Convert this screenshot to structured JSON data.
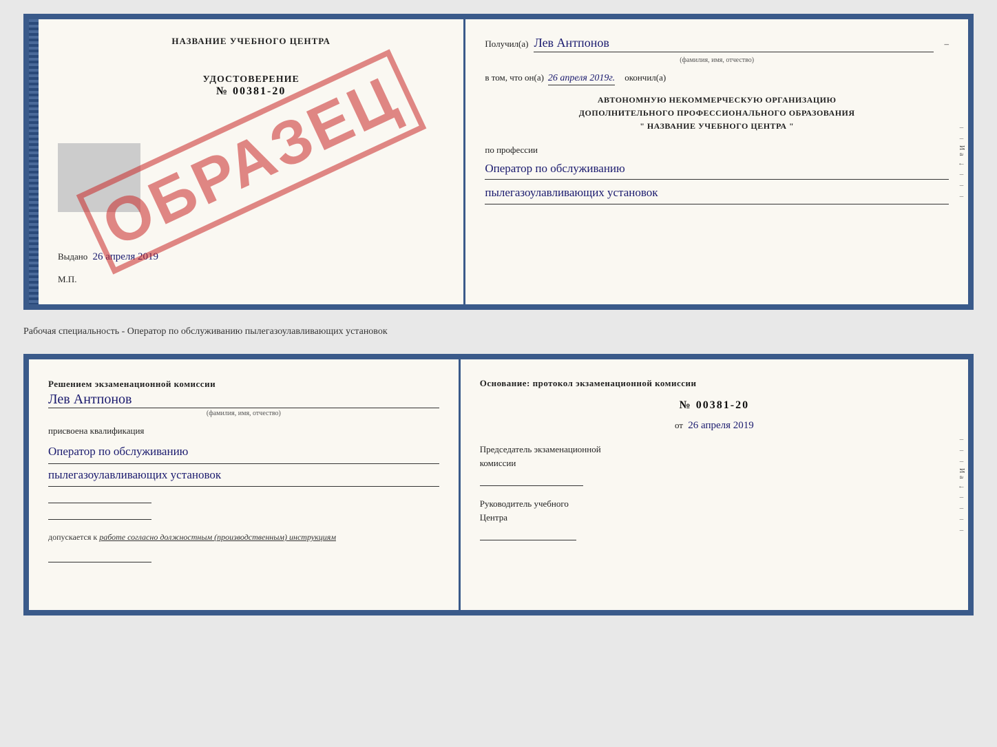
{
  "topBook": {
    "leftPage": {
      "header": "НАЗВАНИЕ УЧЕБНОГО ЦЕНТРА",
      "stamp": "ОБРАЗЕЦ",
      "udostoverenie_label": "УДОСТОВЕРЕНИЕ",
      "number": "№ 00381-20",
      "vydano_label": "Выдано",
      "vydano_date": "26 апреля 2019",
      "mp": "М.П."
    },
    "rightPage": {
      "poluchil_label": "Получил(а)",
      "recipient_name": "Лев Антпонов",
      "fio_subtitle": "(фамилия, имя, отчество)",
      "vtom_prefix": "в том, что он(а)",
      "vtom_date": "26 апреля 2019г.",
      "okoncil_label": "окончил(а)",
      "org_line1": "АВТОНОМНУЮ НЕКОММЕРЧЕСКУЮ ОРГАНИЗАЦИЮ",
      "org_line2": "ДОПОЛНИТЕЛЬНОГО ПРОФЕССИОНАЛЬНОГО ОБРАЗОВАНИЯ",
      "org_line3": "\"   НАЗВАНИЕ УЧЕБНОГО ЦЕНТРА   \"",
      "po_professii": "по профессии",
      "profession_line1": "Оператор по обслуживанию",
      "profession_line2": "пылегазоулавливающих установок"
    }
  },
  "separator": {
    "text": "Рабочая специальность - Оператор по обслуживанию пылегазоулавливающих установок"
  },
  "bottomBook": {
    "leftPage": {
      "resheniem_label": "Решением экзаменационной комиссии",
      "name": "Лев Антпонов",
      "fio_subtitle": "(фамилия, имя, отчество)",
      "prisvoena_label": "присвоена квалификация",
      "qualification_line1": "Оператор по обслуживанию",
      "qualification_line2": "пылегазоулавливающих установок",
      "dopuskaetsya_prefix": "допускается к",
      "dopuskaetsya_text": "работе согласно должностным (производственным) инструкциям"
    },
    "rightPage": {
      "osnovanie_label": "Основание: протокол экзаменационной комиссии",
      "number": "№ 00381-20",
      "ot_prefix": "от",
      "ot_date": "26 апреля 2019",
      "predsedatel_line1": "Председатель экзаменационной",
      "predsedatel_line2": "комиссии",
      "rukovoditel_line1": "Руководитель учебного",
      "rukovoditel_line2": "Центра"
    },
    "rightSide": {
      "markers": [
        "–",
        "–",
        "–",
        "И",
        "а",
        "←",
        "–",
        "–",
        "–",
        "–"
      ]
    }
  }
}
